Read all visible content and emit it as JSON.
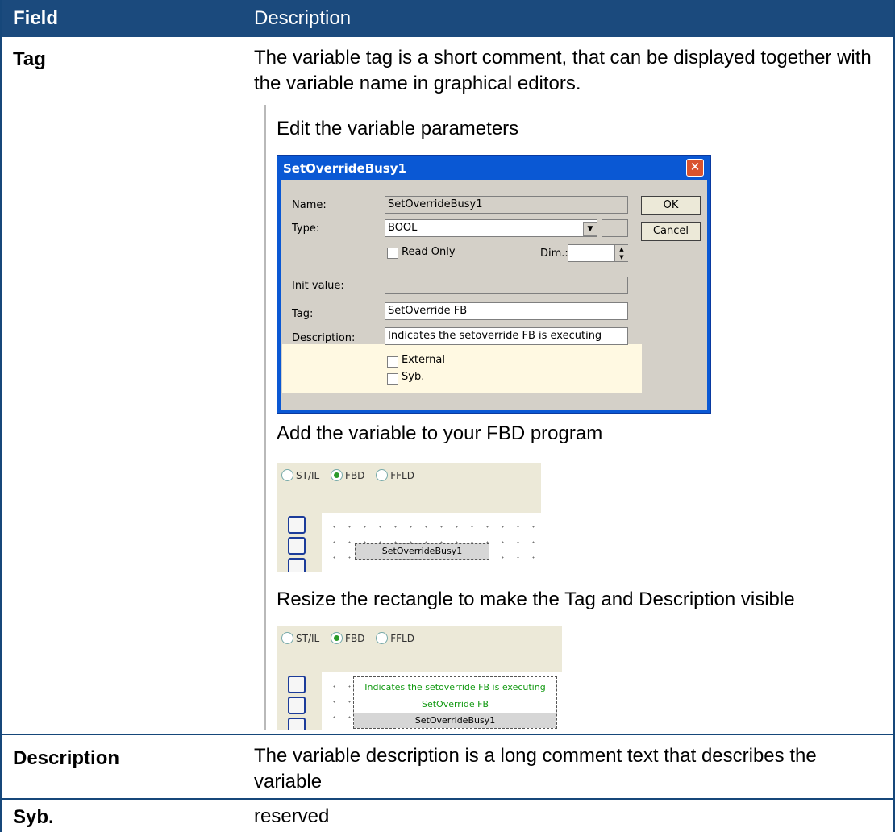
{
  "table": {
    "header": {
      "field": "Field",
      "description": "Description"
    },
    "rows": [
      {
        "field": "Tag",
        "description": "The variable tag is a short comment, that can be displayed together with the variable name in graphical editors."
      },
      {
        "field": "Description",
        "description": "The variable description is a long comment text that describes the variable"
      },
      {
        "field": "Syb.",
        "description": "reserved"
      }
    ]
  },
  "note": {
    "step1": "Edit the variable parameters",
    "step2": "Add the variable to your FBD program",
    "step3": "Resize the rectangle to make the Tag and Description visible"
  },
  "dialog": {
    "title": "SetOverrideBusy1",
    "close_glyph": "✕",
    "labels": {
      "name": "Name:",
      "type": "Type:",
      "init": "Init value:",
      "tag": "Tag:",
      "description": "Description:",
      "dim": "Dim.:"
    },
    "values": {
      "name": "SetOverrideBusy1",
      "type": "BOOL",
      "init": "",
      "tag": "SetOverride FB",
      "description": "Indicates the setoverride FB is executing"
    },
    "checkboxes": {
      "read_only": "Read Only",
      "external": "External",
      "syb": "Syb."
    },
    "buttons": {
      "ok": "OK",
      "cancel": "Cancel"
    }
  },
  "fbd": {
    "radio_options": [
      "ST/IL",
      "FBD",
      "FFLD"
    ],
    "selected": "FBD",
    "block_name": "SetOverrideBusy1",
    "block_description": "Indicates the setoverride FB is executing",
    "block_tag": "SetOverride FB"
  }
}
